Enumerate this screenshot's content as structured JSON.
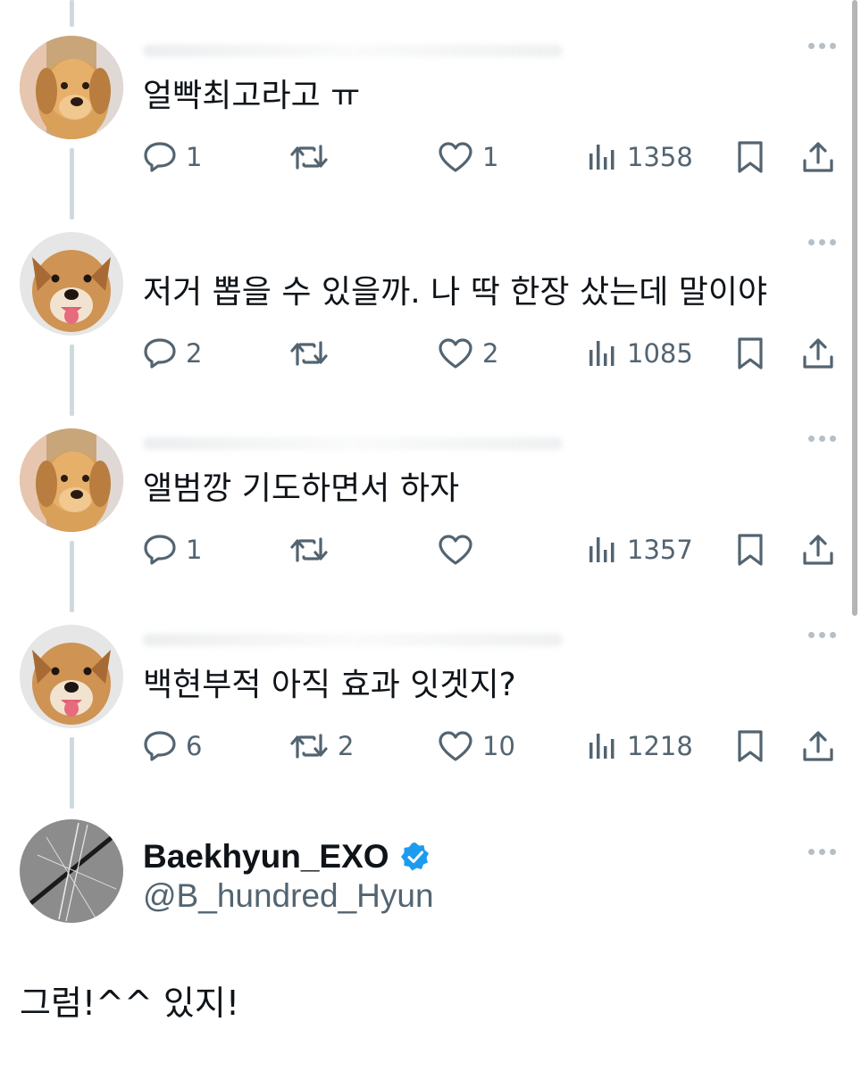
{
  "colors": {
    "text": "#0f1419",
    "muted": "#536471",
    "thread_line": "#cfd9de",
    "verified": "#1d9bf0"
  },
  "tweets": [
    {
      "text": "얼빡최고라고 ㅠ",
      "reply_count": "1",
      "retweet_count": "",
      "like_count": "1",
      "view_count": "1358",
      "avatar_icon": "golden-puppy-avatar"
    },
    {
      "text": "저거 뽑을 수 있을까. 나 딱 한장 샀는데 말이야",
      "reply_count": "2",
      "retweet_count": "",
      "like_count": "2",
      "view_count": "1085",
      "avatar_icon": "smiling-dog-avatar"
    },
    {
      "text": "앨범깡 기도하면서 하자",
      "reply_count": "1",
      "retweet_count": "",
      "like_count": "",
      "view_count": "1357",
      "avatar_icon": "golden-puppy-avatar"
    },
    {
      "text": "백현부적 아직 효과 잇겟지?",
      "reply_count": "6",
      "retweet_count": "2",
      "like_count": "10",
      "view_count": "1218",
      "avatar_icon": "smiling-dog-avatar"
    }
  ],
  "author": {
    "name": "Baekhyun_EXO",
    "handle": "@B_hundred_Hyun",
    "verified": true,
    "avatar_icon": "abstract-lines-avatar"
  },
  "reply": {
    "text": "그럼!^^ 있지!"
  }
}
